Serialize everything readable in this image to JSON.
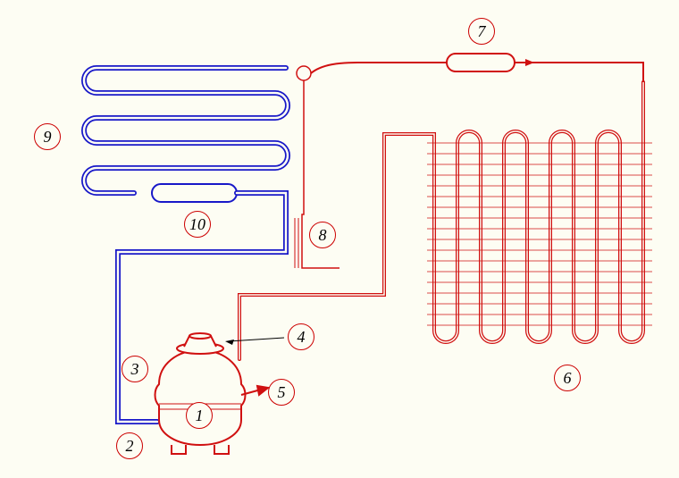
{
  "labels": {
    "c1": "1",
    "c2": "2",
    "c3": "3",
    "c4": "4",
    "c5": "5",
    "c6": "6",
    "c7": "7",
    "c8": "8",
    "c9": "9",
    "c10": "10"
  },
  "colors": {
    "hot": "#d01010",
    "cold": "#1818c8",
    "bg": "#fdfdf3"
  },
  "components": {
    "c1": "compressor",
    "c2": "suction-line",
    "c3": "discharge-line",
    "c4": "compressor-top-cap",
    "c5": "process-tube",
    "c6": "condenser-coil",
    "c7": "filter-drier",
    "c8": "capillary-junction",
    "c9": "evaporator-coil",
    "c10": "accumulator"
  }
}
